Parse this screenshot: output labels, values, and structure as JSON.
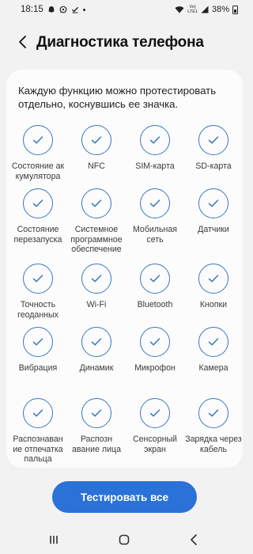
{
  "status_bar": {
    "time": "18:15",
    "network_type": "VoLTE LTE1",
    "network_top": "Vo)",
    "network_bottom": "LTE1",
    "battery": "38%",
    "icons": [
      "snapchat-ghost-icon",
      "whatsapp-icon",
      "check-icon",
      "dot-icon",
      "wifi-icon",
      "signal-icon",
      "battery-icon"
    ]
  },
  "header": {
    "title": "Диагностика телефона",
    "back_icon": "chevron-left-icon"
  },
  "card": {
    "intro": "Каждую функцию можно протестировать отдельно, коснувшись ее значка."
  },
  "tests": [
    {
      "label": "Состояние ак кумулятора",
      "icon": "check-circle-icon"
    },
    {
      "label": "NFC",
      "icon": "check-circle-icon"
    },
    {
      "label": "SIM-карта",
      "icon": "check-circle-icon"
    },
    {
      "label": "SD-карта",
      "icon": "check-circle-icon"
    },
    {
      "label": "Состояние перезапуска",
      "icon": "check-circle-icon"
    },
    {
      "label": "Системное программное обеспечение",
      "icon": "check-circle-icon"
    },
    {
      "label": "Мобильная сеть",
      "icon": "check-circle-icon"
    },
    {
      "label": "Датчики",
      "icon": "check-circle-icon"
    },
    {
      "label": "Точность геоданных",
      "icon": "check-circle-icon"
    },
    {
      "label": "Wi-Fi",
      "icon": "check-circle-icon"
    },
    {
      "label": "Bluetooth",
      "icon": "check-circle-icon"
    },
    {
      "label": "Кнопки",
      "icon": "check-circle-icon"
    },
    {
      "label": "Вибрация",
      "icon": "check-circle-icon"
    },
    {
      "label": "Динамик",
      "icon": "check-circle-icon"
    },
    {
      "label": "Микрофон",
      "icon": "check-circle-icon"
    },
    {
      "label": "Камера",
      "icon": "check-circle-icon"
    },
    {
      "label": "Распознаван ие отпечатка пальца",
      "icon": "check-circle-icon"
    },
    {
      "label": "Распозн авание лица",
      "icon": "check-circle-icon"
    },
    {
      "label": "Сенсорный экран",
      "icon": "check-circle-icon"
    },
    {
      "label": "Зарядка через кабель",
      "icon": "check-circle-icon"
    }
  ],
  "actions": {
    "test_all_label": "Тестировать все"
  },
  "nav_bar": {
    "buttons": [
      "recent-apps-icon",
      "home-icon",
      "back-icon"
    ]
  },
  "colors": {
    "accent": "#2a72d8",
    "check_blue": "#3a78c3",
    "background": "#f2f2f2",
    "card": "#fcfcfc"
  }
}
